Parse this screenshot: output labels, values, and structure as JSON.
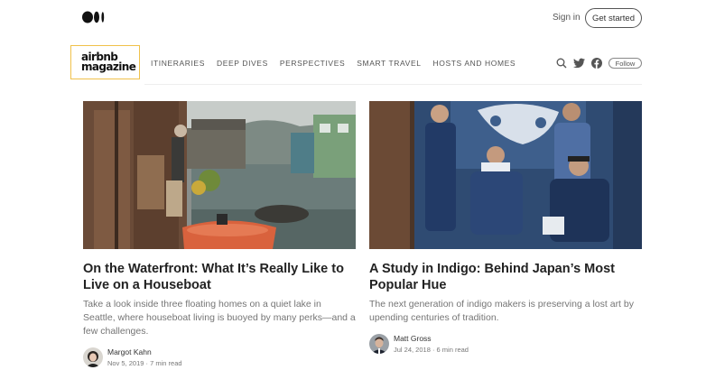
{
  "header": {
    "logo_icon": "medium-logo-icon",
    "signin_label": "Sign in",
    "getstarted_label": "Get started"
  },
  "publication": {
    "logo_line1": "airbnb",
    "logo_line2": "magazine",
    "accent_color": "#f0c14b",
    "nav": [
      "ITINERARIES",
      "DEEP DIVES",
      "PERSPECTIVES",
      "SMART TRAVEL",
      "HOSTS AND HOMES"
    ],
    "icons": [
      "search-icon",
      "twitter-icon",
      "facebook-icon"
    ],
    "follow_label": "Follow"
  },
  "articles": [
    {
      "title": "On the Waterfront: What It’s Really Like to Live on a Houseboat",
      "excerpt": "Take a look inside three floating homes on a quiet lake in Seattle, where houseboat living is buoyed by many perks—and a few challenges.",
      "author": "Margot Kahn",
      "date": "Nov 5, 2019",
      "read_time": "7 min read",
      "meta": "Nov 5, 2019 · 7 min read"
    },
    {
      "title": "A Study in Indigo: Behind Japan’s Most Popular Hue",
      "excerpt": "The next generation of indigo makers is preserving a lost art by upending centuries of tradition.",
      "author": "Matt Gross",
      "date": "Jul 24, 2018",
      "read_time": "6 min read",
      "meta": "Jul 24, 2018 · 6 min read"
    }
  ]
}
